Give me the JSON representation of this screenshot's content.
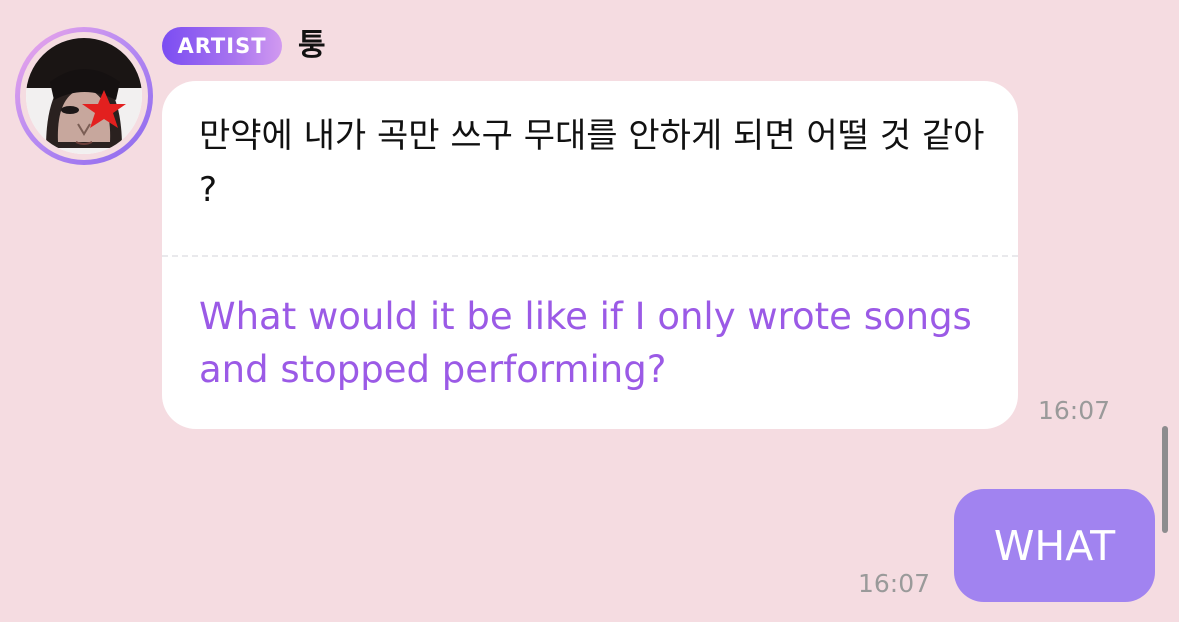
{
  "app": {
    "background_color": "#f5dce1",
    "accent_color": "#9b5ae6"
  },
  "incoming": {
    "badge": "ARTIST",
    "sender_name": "퉁",
    "avatar_icon": "artist-profile-photo",
    "original_text": "만약에 내가 곡만 쓰구 무대를 안하게 되면 어떨 것 같아 ?",
    "translation_text": "What would it be like if I only wrote songs and stopped performing?",
    "timestamp": "16:07"
  },
  "outgoing": {
    "text": "WHAT",
    "timestamp": "16:07",
    "bubble_color": "#a183f0"
  }
}
